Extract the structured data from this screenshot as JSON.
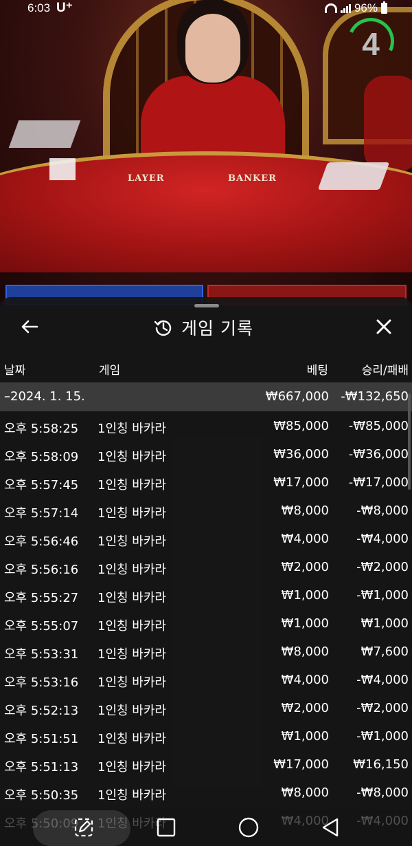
{
  "status_bar": {
    "time": "6:03",
    "carrier": "U⁺",
    "battery": "96%"
  },
  "video": {
    "table_labels": [
      "LAYER",
      "BANKER"
    ],
    "countdown": "4"
  },
  "history": {
    "title": "게임 기록",
    "columns": {
      "date": "날짜",
      "game": "게임",
      "bet": "베팅",
      "win_loss": "승리/패배"
    },
    "date_group": {
      "date": "–2024. 1. 15.",
      "total_bet": "₩667,000",
      "total_win_loss": "-₩132,650"
    },
    "rows": [
      {
        "time": "오후 5:58:25",
        "game": "1인칭 바카라",
        "bet": "₩85,000",
        "result": "-₩85,000"
      },
      {
        "time": "오후 5:58:09",
        "game": "1인칭 바카라",
        "bet": "₩36,000",
        "result": "-₩36,000"
      },
      {
        "time": "오후 5:57:45",
        "game": "1인칭 바카라",
        "bet": "₩17,000",
        "result": "-₩17,000"
      },
      {
        "time": "오후 5:57:14",
        "game": "1인칭 바카라",
        "bet": "₩8,000",
        "result": "-₩8,000"
      },
      {
        "time": "오후 5:56:46",
        "game": "1인칭 바카라",
        "bet": "₩4,000",
        "result": "-₩4,000"
      },
      {
        "time": "오후 5:56:16",
        "game": "1인칭 바카라",
        "bet": "₩2,000",
        "result": "-₩2,000"
      },
      {
        "time": "오후 5:55:27",
        "game": "1인칭 바카라",
        "bet": "₩1,000",
        "result": "-₩1,000"
      },
      {
        "time": "오후 5:55:07",
        "game": "1인칭 바카라",
        "bet": "₩1,000",
        "result": "₩1,000"
      },
      {
        "time": "오후 5:53:31",
        "game": "1인칭 바카라",
        "bet": "₩8,000",
        "result": "₩7,600"
      },
      {
        "time": "오후 5:53:16",
        "game": "1인칭 바카라",
        "bet": "₩4,000",
        "result": "-₩4,000"
      },
      {
        "time": "오후 5:52:13",
        "game": "1인칭 바카라",
        "bet": "₩2,000",
        "result": "-₩2,000"
      },
      {
        "time": "오후 5:51:51",
        "game": "1인칭 바카라",
        "bet": "₩1,000",
        "result": "-₩1,000"
      },
      {
        "time": "오후 5:51:13",
        "game": "1인칭 바카라",
        "bet": "₩17,000",
        "result": "₩16,150"
      },
      {
        "time": "오후 5:50:35",
        "game": "1인칭 바카라",
        "bet": "₩8,000",
        "result": "-₩8,000"
      },
      {
        "time": "오후 5:50:09",
        "game": "1인칭 바카라",
        "bet": "₩4,000",
        "result": "-₩4,000"
      }
    ]
  },
  "nav": {
    "icons": [
      "edit-icon",
      "recents-icon",
      "home-icon",
      "back-nav-icon"
    ]
  }
}
